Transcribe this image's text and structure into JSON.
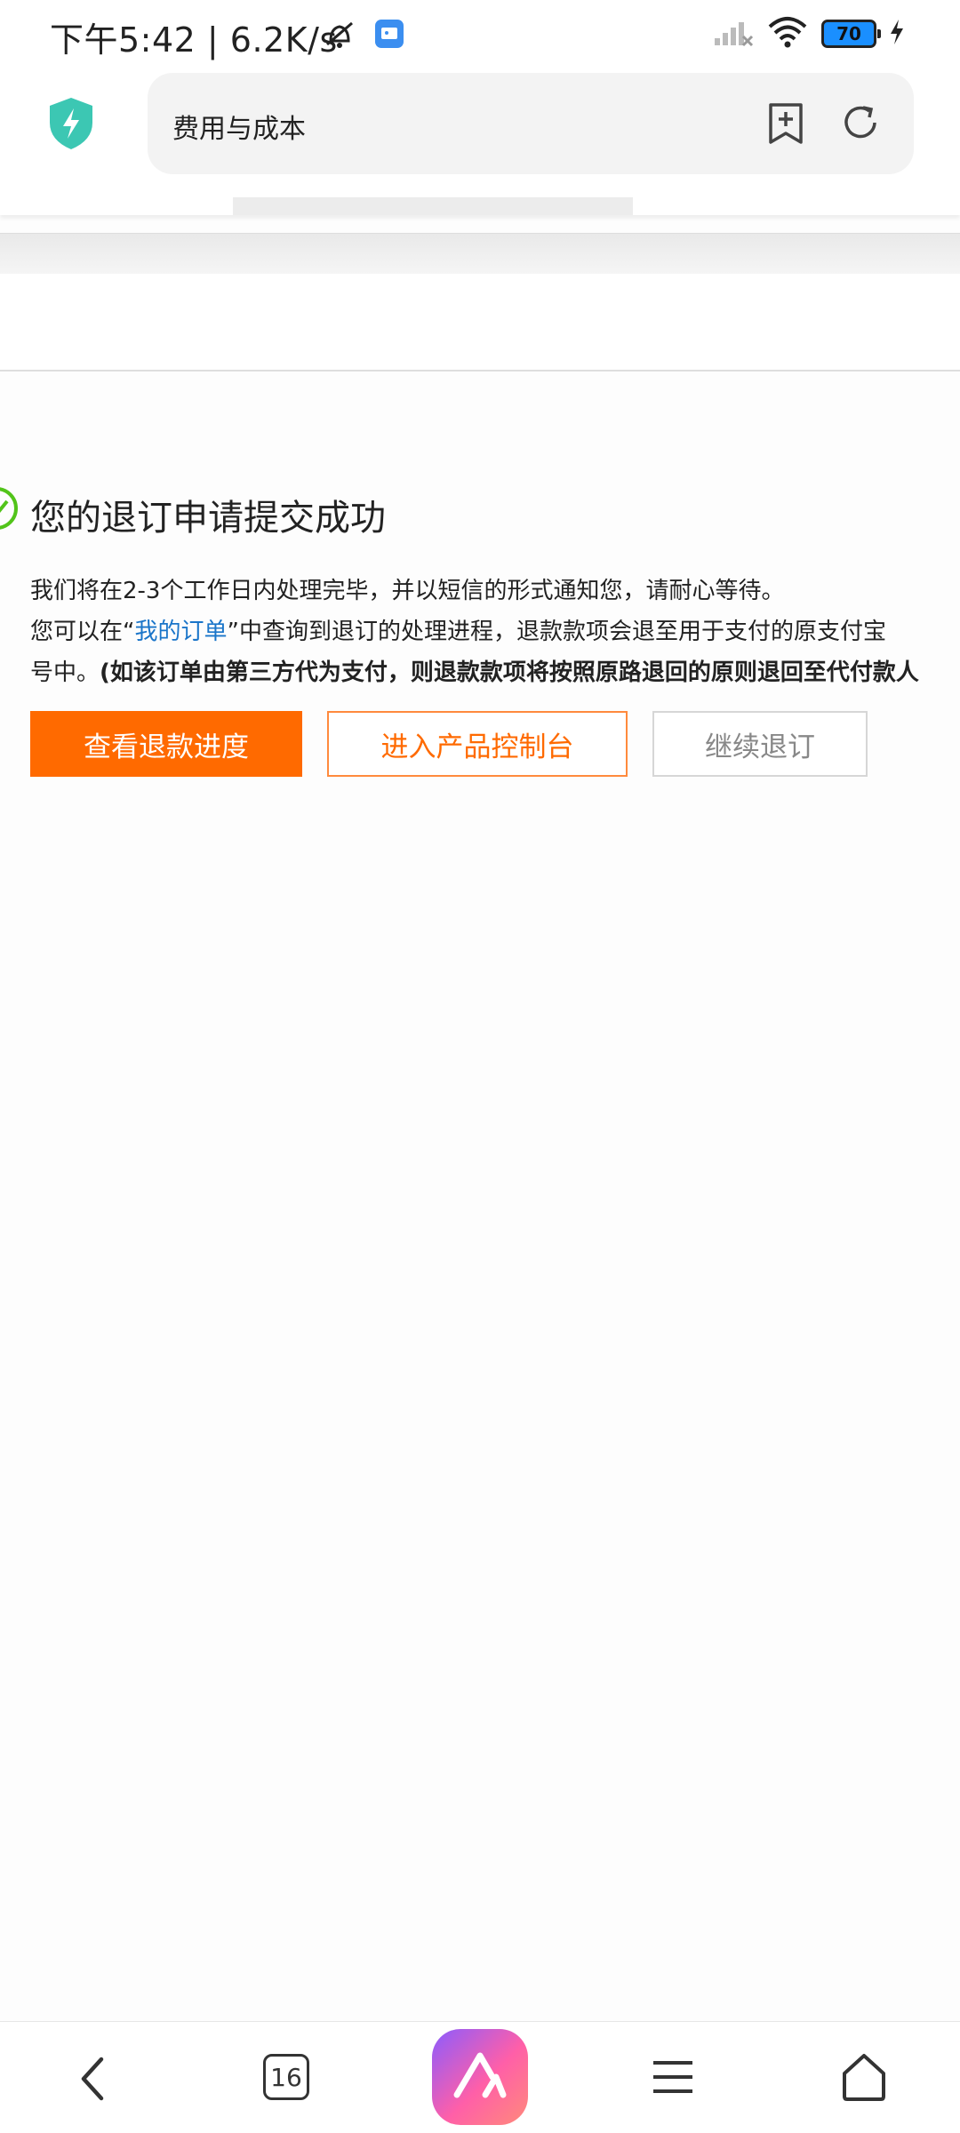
{
  "status_bar": {
    "time": "下午5:42 | 6.2K/s",
    "battery": "70",
    "icons": [
      "mute-bell-icon",
      "app-notification-icon",
      "signal-icon",
      "wifi-icon",
      "battery-icon",
      "charging-icon"
    ]
  },
  "browser": {
    "url_text": "费用与成本",
    "tab_count": "16"
  },
  "result": {
    "title": "您的退订申请提交成功",
    "line1": "我们将在2-3个工作日内处理完毕，并以短信的形式通知您，请耐心等待。",
    "line2_prefix": "您可以在“",
    "line2_link": "我的订单",
    "line2_suffix": "”中查询到退订的处理进程，退款款项会退至用于支付的原支付宝",
    "line3_prefix": "号中。",
    "line3_bold": "(如该订单由第三方代为支付，则退款款项将按照原路退回的原则退回至代付款人"
  },
  "buttons": {
    "refund_progress": "查看退款进度",
    "console": "进入产品控制台",
    "continue": "继续退订"
  },
  "colors": {
    "accent": "#ff6a00",
    "link": "#1a75c9",
    "success": "#52c41a"
  }
}
